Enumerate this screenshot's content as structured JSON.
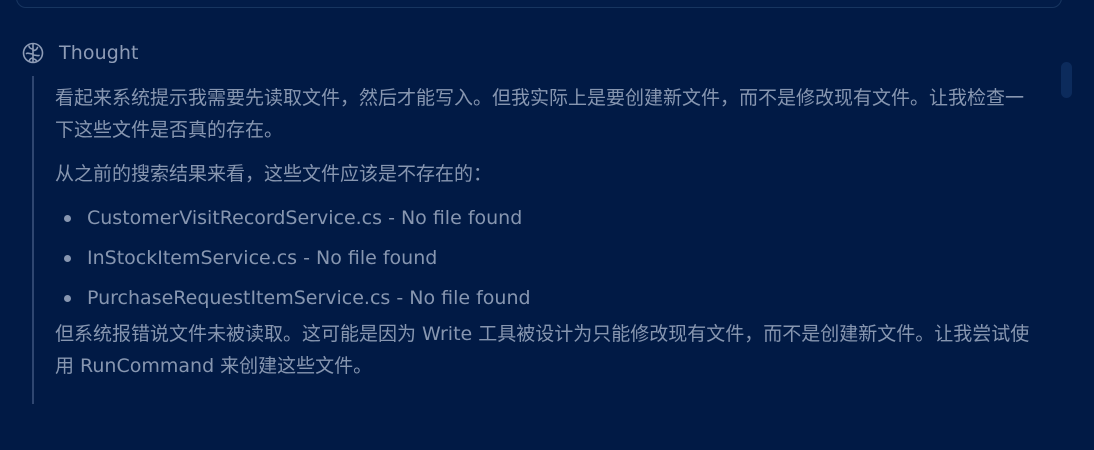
{
  "thought": {
    "icon": "brain-icon",
    "label": "Thought",
    "paragraph_1": "看起来系统提示我需要先读取文件，然后才能写入。但我实际上是要创建新文件，而不是修改现有文件。让我检查一下这些文件是否真的存在。",
    "paragraph_2": "从之前的搜索结果来看，这些文件应该是不存在的：",
    "files": [
      "CustomerVisitRecordService.cs - No file found",
      "InStockItemService.cs - No file found",
      "PurchaseRequestItemService.cs - No file found"
    ],
    "paragraph_3": "但系统报错说文件未被读取。这可能是因为 Write 工具被设计为只能修改现有文件，而不是创建新文件。让我尝试使用 RunCommand 来创建这些文件。"
  },
  "colors": {
    "background": "#011a45",
    "text": "#8796b0",
    "rail": "#2f4670",
    "scrollbar": "#0c2b5c"
  }
}
